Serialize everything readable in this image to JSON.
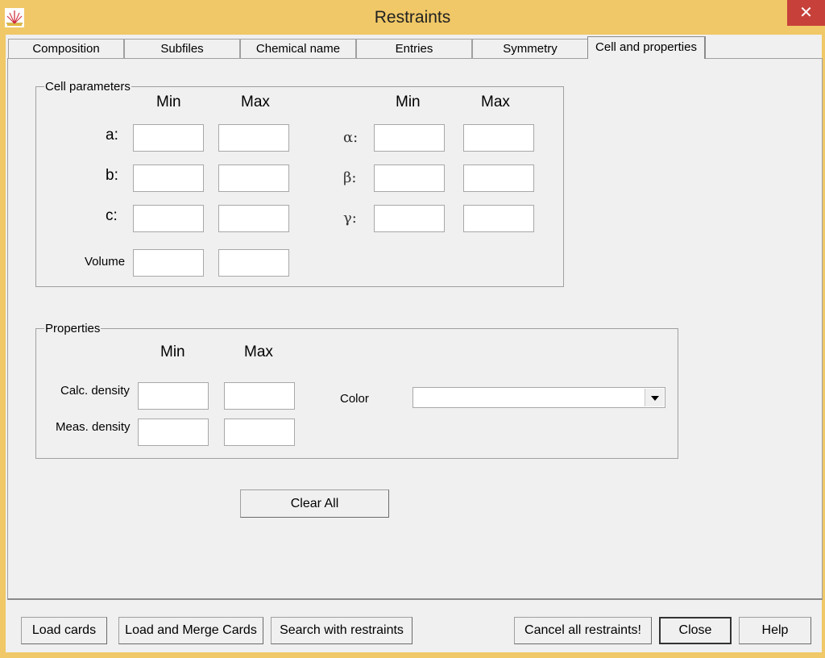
{
  "window": {
    "title": "Restraints",
    "close_glyph": "✕"
  },
  "tabs": [
    {
      "label": "Composition"
    },
    {
      "label": "Subfiles"
    },
    {
      "label": "Chemical name"
    },
    {
      "label": "Entries"
    },
    {
      "label": "Symmetry"
    },
    {
      "label": "Cell and properties",
      "active": true
    }
  ],
  "cell_parameters": {
    "title": "Cell parameters",
    "min_label": "Min",
    "max_label": "Max",
    "rows_left": [
      {
        "label": "a:",
        "min": "",
        "max": ""
      },
      {
        "label": "b:",
        "min": "",
        "max": ""
      },
      {
        "label": "c:",
        "min": "",
        "max": ""
      }
    ],
    "rows_right": [
      {
        "label": "α:",
        "min": "",
        "max": ""
      },
      {
        "label": "β:",
        "min": "",
        "max": ""
      },
      {
        "label": "γ:",
        "min": "",
        "max": ""
      }
    ],
    "volume": {
      "label": "Volume",
      "min": "",
      "max": ""
    }
  },
  "properties": {
    "title": "Properties",
    "min_label": "Min",
    "max_label": "Max",
    "calc_density": {
      "label": "Calc. density",
      "min": "",
      "max": ""
    },
    "meas_density": {
      "label": "Meas. density",
      "min": "",
      "max": ""
    },
    "color": {
      "label": "Color",
      "value": ""
    }
  },
  "clear_all_label": "Clear All",
  "bottom_buttons": {
    "load_cards": "Load cards",
    "load_merge": "Load and Merge Cards",
    "search": "Search with restraints",
    "cancel_all": "Cancel all restraints!",
    "close": "Close",
    "help": "Help"
  },
  "colors": {
    "titlebar": "#f0c867",
    "close": "#c7403a",
    "panel": "#f0f0f0"
  }
}
